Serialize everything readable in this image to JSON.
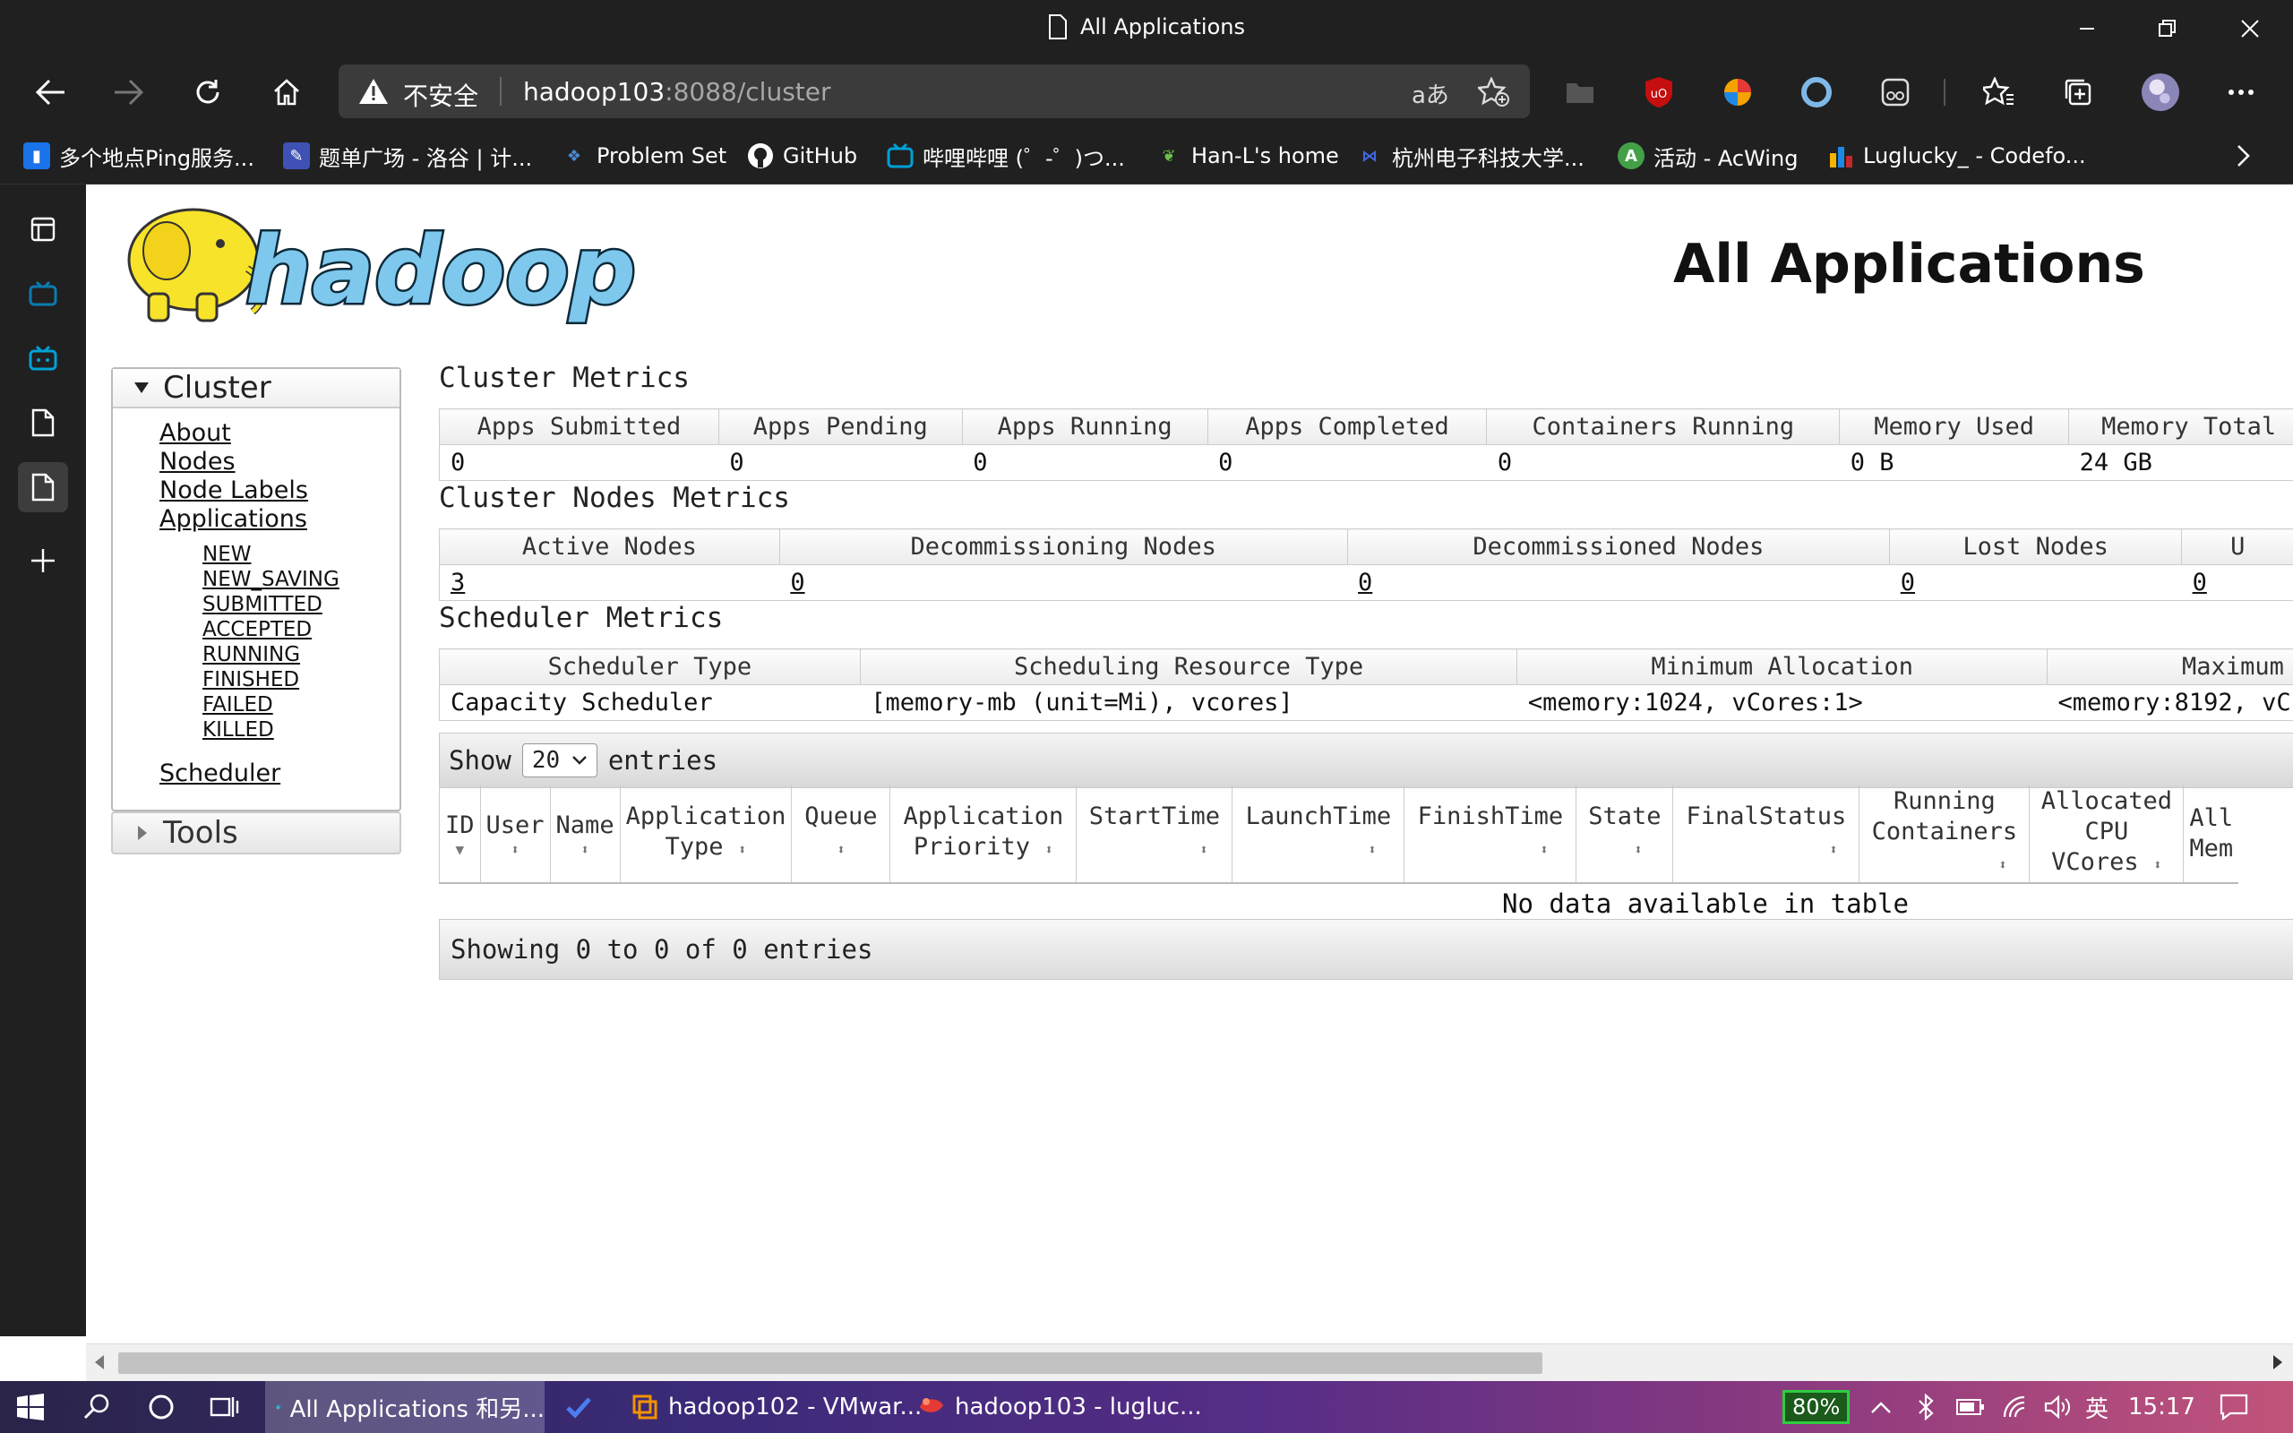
{
  "window": {
    "title": "All Applications"
  },
  "browser": {
    "insecure_label": "不安全",
    "url_host": "hadoop103",
    "url_path": ":8088/cluster"
  },
  "bookmarks": [
    {
      "label": "多个地点Ping服务...",
      "icon": "ping-icon",
      "color": "#1a73e8"
    },
    {
      "label": "题单广场 - 洛谷 | 计...",
      "icon": "luogu-icon",
      "color": "#3f51b5"
    },
    {
      "label": "Problem Set",
      "icon": "problemset-icon",
      "color": "#2f6fb0"
    },
    {
      "label": "GitHub",
      "icon": "github-icon",
      "color": "#ffffff"
    },
    {
      "label": "哔哩哔哩 (゜-゜)つ...",
      "icon": "bilibili-icon",
      "color": "#00a1d6"
    },
    {
      "label": "Han-L's home",
      "icon": "leaf-icon",
      "color": "#5cb85c"
    },
    {
      "label": "杭州电子科技大学...",
      "icon": "hdu-icon",
      "color": "#4169e1"
    },
    {
      "label": "活动 - AcWing",
      "icon": "acwing-icon",
      "color": "#43a047"
    },
    {
      "label": "Luglucky_ - Codefo...",
      "icon": "codeforces-icon",
      "color": "#f5b400"
    }
  ],
  "page": {
    "logo_text": "hadoop",
    "title": "All Applications",
    "nav": {
      "cluster": "Cluster",
      "about": "About",
      "nodes": "Nodes",
      "node_labels": "Node Labels",
      "applications": "Applications",
      "states": [
        "NEW",
        "NEW_SAVING",
        "SUBMITTED",
        "ACCEPTED",
        "RUNNING",
        "FINISHED",
        "FAILED",
        "KILLED"
      ],
      "scheduler": "Scheduler",
      "tools": "Tools"
    },
    "cluster_metrics": {
      "title": "Cluster Metrics",
      "headers": [
        "Apps Submitted",
        "Apps Pending",
        "Apps Running",
        "Apps Completed",
        "Containers Running",
        "Memory Used",
        "Memory Total"
      ],
      "values": [
        "0",
        "0",
        "0",
        "0",
        "0",
        "0 B",
        "24 GB"
      ]
    },
    "nodes_metrics": {
      "title": "Cluster Nodes Metrics",
      "headers": [
        "Active Nodes",
        "Decommissioning Nodes",
        "Decommissioned Nodes",
        "Lost Nodes",
        "U"
      ],
      "values": [
        "3",
        "0",
        "0",
        "0",
        "0"
      ]
    },
    "scheduler_metrics": {
      "title": "Scheduler Metrics",
      "headers": [
        "Scheduler Type",
        "Scheduling Resource Type",
        "Minimum Allocation",
        "Maximum"
      ],
      "values": [
        "Capacity Scheduler",
        "[memory-mb (unit=Mi), vcores]",
        "<memory:1024, vCores:1>",
        "<memory:8192, vC"
      ]
    },
    "datatable": {
      "show": "Show",
      "page_size": "20",
      "entries": "entries",
      "columns": [
        [
          "ID"
        ],
        [
          "User"
        ],
        [
          "Name"
        ],
        [
          "Application",
          "Type"
        ],
        [
          "Queue"
        ],
        [
          "Application",
          "Priority"
        ],
        [
          "StartTime"
        ],
        [
          "LaunchTime"
        ],
        [
          "FinishTime"
        ],
        [
          "State"
        ],
        [
          "FinalStatus"
        ],
        [
          "Running",
          "Containers"
        ],
        [
          "Allocated",
          "CPU",
          "VCores"
        ],
        [
          "All",
          "Mem"
        ]
      ],
      "empty": "No data available in table",
      "info": "Showing 0 to 0 of 0 entries"
    }
  },
  "taskbar": {
    "apps": [
      {
        "label": "All Applications 和另...",
        "icon": "edge-icon"
      },
      {
        "label": "",
        "icon": "todo-icon"
      },
      {
        "label": "hadoop102 - VMwar...",
        "icon": "vmware-icon"
      },
      {
        "label": "hadoop103 - lugluc...",
        "icon": "xshell-icon"
      }
    ],
    "battery": "80%",
    "ime": "英",
    "time": "15:17"
  }
}
